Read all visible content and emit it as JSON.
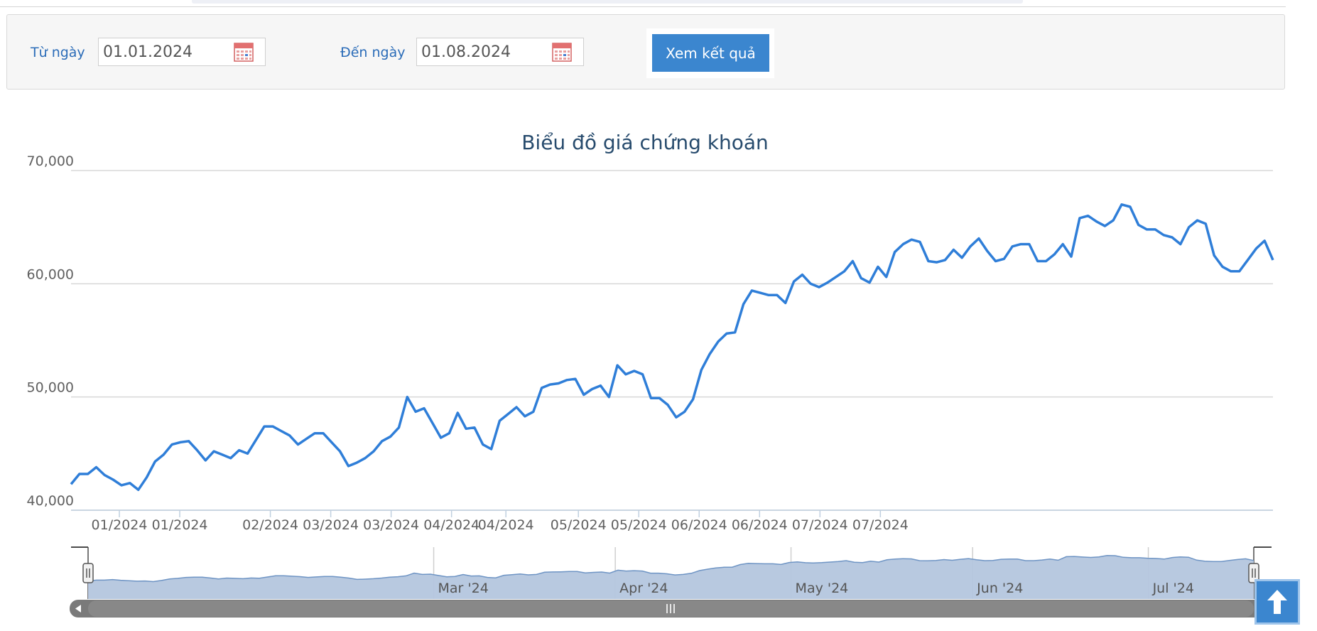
{
  "filter": {
    "from_label": "Từ ngày",
    "from_value": "01.01.2024",
    "to_label": "Đến ngày",
    "to_value": "01.08.2024",
    "submit_label": "Xem kết quả"
  },
  "icons": {
    "calendar": "calendar-icon",
    "scroll_top": "arrow-up-icon"
  },
  "colors": {
    "accent": "#3b86cf",
    "line": "#2f7ed8",
    "navigator_fill": "#b4c6de",
    "navigator_line": "#6e94c4"
  },
  "chart_data": {
    "type": "line",
    "title": "Biểu đồ giá chứng khoán",
    "ylim": [
      40000,
      70000
    ],
    "y_ticks": [
      "40,000",
      "50,000",
      "60,000",
      "70,000"
    ],
    "x_ticks": [
      "01/2024",
      "01/2024",
      "02/2024",
      "03/2024",
      "03/2024",
      "04/2024",
      "04/2024",
      "05/2024",
      "05/2024",
      "06/2024",
      "06/2024",
      "07/2024",
      "07/2024"
    ],
    "x_tick_dates": [
      "2024-01-10",
      "2024-01-20",
      "2024-02-04",
      "2024-02-14",
      "2024-02-24",
      "2024-03-05",
      "2024-03-14",
      "2024-03-26",
      "2024-04-05",
      "2024-04-15",
      "2024-04-25",
      "2024-05-05",
      "2024-05-15"
    ],
    "navigator_labels": [
      "Mar '24",
      "Apr '24",
      "May '24",
      "Jun '24",
      "Jul '24"
    ],
    "navigator_label_dates": [
      "2024-03-01",
      "2024-04-01",
      "2024-05-01",
      "2024-06-01",
      "2024-07-01"
    ],
    "series": [
      {
        "dates": [
          "2024-01-02",
          "2024-01-03",
          "2024-01-04",
          "2024-01-05",
          "2024-01-08",
          "2024-01-09",
          "2024-01-10",
          "2024-01-11",
          "2024-01-12",
          "2024-01-15",
          "2024-01-16",
          "2024-01-17",
          "2024-01-18",
          "2024-01-19",
          "2024-01-22",
          "2024-01-23",
          "2024-01-24",
          "2024-01-25",
          "2024-01-26",
          "2024-01-29",
          "2024-01-30",
          "2024-01-31",
          "2024-02-01",
          "2024-02-02",
          "2024-02-05",
          "2024-02-06",
          "2024-02-07",
          "2024-02-08",
          "2024-02-09",
          "2024-02-12",
          "2024-02-13",
          "2024-02-14",
          "2024-02-15",
          "2024-02-16",
          "2024-02-19",
          "2024-02-20",
          "2024-02-21",
          "2024-02-22",
          "2024-02-23",
          "2024-02-26",
          "2024-02-27",
          "2024-02-28",
          "2024-02-29",
          "2024-03-01",
          "2024-03-04",
          "2024-03-05",
          "2024-03-06",
          "2024-03-07",
          "2024-03-08",
          "2024-03-11",
          "2024-03-12",
          "2024-03-13",
          "2024-03-14",
          "2024-03-15",
          "2024-03-18",
          "2024-03-19",
          "2024-03-20",
          "2024-03-21",
          "2024-03-22",
          "2024-03-25",
          "2024-03-26",
          "2024-03-27",
          "2024-03-28",
          "2024-03-29",
          "2024-04-01",
          "2024-04-02",
          "2024-04-03",
          "2024-04-04",
          "2024-04-05",
          "2024-04-08",
          "2024-04-09",
          "2024-04-10",
          "2024-04-11",
          "2024-04-12",
          "2024-04-15",
          "2024-04-16",
          "2024-04-17",
          "2024-04-18",
          "2024-04-19",
          "2024-04-22",
          "2024-04-23",
          "2024-04-24",
          "2024-04-25",
          "2024-04-26",
          "2024-04-29",
          "2024-04-30",
          "2024-05-01",
          "2024-05-02",
          "2024-05-03",
          "2024-05-06",
          "2024-05-07",
          "2024-05-08",
          "2024-05-09",
          "2024-05-10",
          "2024-05-13",
          "2024-05-14",
          "2024-05-15",
          "2024-05-16",
          "2024-05-17",
          "2024-05-20",
          "2024-05-21",
          "2024-05-22",
          "2024-05-23",
          "2024-05-24",
          "2024-05-27",
          "2024-05-28",
          "2024-05-29",
          "2024-05-30",
          "2024-05-31",
          "2024-06-03",
          "2024-06-04",
          "2024-06-05",
          "2024-06-06",
          "2024-06-07",
          "2024-06-10",
          "2024-06-11",
          "2024-06-12",
          "2024-06-13",
          "2024-06-14",
          "2024-06-17",
          "2024-06-18",
          "2024-06-19",
          "2024-06-20",
          "2024-06-21",
          "2024-06-24",
          "2024-06-25",
          "2024-06-26",
          "2024-06-27",
          "2024-06-28",
          "2024-07-01",
          "2024-07-02",
          "2024-07-03",
          "2024-07-04",
          "2024-07-05",
          "2024-07-08",
          "2024-07-09",
          "2024-07-10",
          "2024-07-11",
          "2024-07-12",
          "2024-07-15",
          "2024-07-16",
          "2024-07-17",
          "2024-07-18",
          "2024-07-19",
          "2024-07-22",
          "2024-07-23",
          "2024-07-24",
          "2024-07-25",
          "2024-07-26",
          "2024-07-29",
          "2024-07-30",
          "2024-07-31",
          "2024-08-01"
        ],
        "values": [
          42300,
          43200,
          43200,
          43800,
          43100,
          42700,
          42200,
          42400,
          41800,
          42900,
          44300,
          44900,
          45800,
          46000,
          46100,
          45300,
          44400,
          45200,
          44900,
          44600,
          45300,
          45000,
          46200,
          47400,
          47400,
          47000,
          46600,
          45800,
          46300,
          46800,
          46800,
          46000,
          45200,
          43900,
          44200,
          44600,
          45200,
          46100,
          46500,
          47300,
          50000,
          48700,
          49000,
          47700,
          46400,
          46800,
          48600,
          47200,
          47300,
          45800,
          45400,
          47900,
          48500,
          49100,
          48300,
          48700,
          50800,
          51100,
          51200,
          51500,
          51600,
          50200,
          50700,
          51000,
          50000,
          52800,
          52000,
          52300,
          52000,
          49900,
          49900,
          49300,
          48200,
          48700,
          49800,
          52400,
          53800,
          54900,
          55600,
          55700,
          58200,
          59400,
          59200,
          59000,
          59000,
          58300,
          60200,
          60800,
          60000,
          59700,
          60100,
          60600,
          61100,
          62000,
          60500,
          60100,
          61500,
          60600,
          62800,
          63500,
          63900,
          63700,
          62000,
          61900,
          62100,
          63000,
          62300,
          63300,
          64000,
          62900,
          62000,
          62200,
          63300,
          63500,
          63500,
          62000,
          62000,
          62600,
          63500,
          62400,
          65800,
          66000,
          65500,
          65100,
          65600,
          67000,
          66800,
          65200,
          64800,
          64800,
          64300,
          64100,
          63500,
          65000,
          65600,
          65300,
          62500,
          61500,
          61100,
          61100,
          62100,
          63100,
          63800,
          62100
        ]
      }
    ]
  }
}
